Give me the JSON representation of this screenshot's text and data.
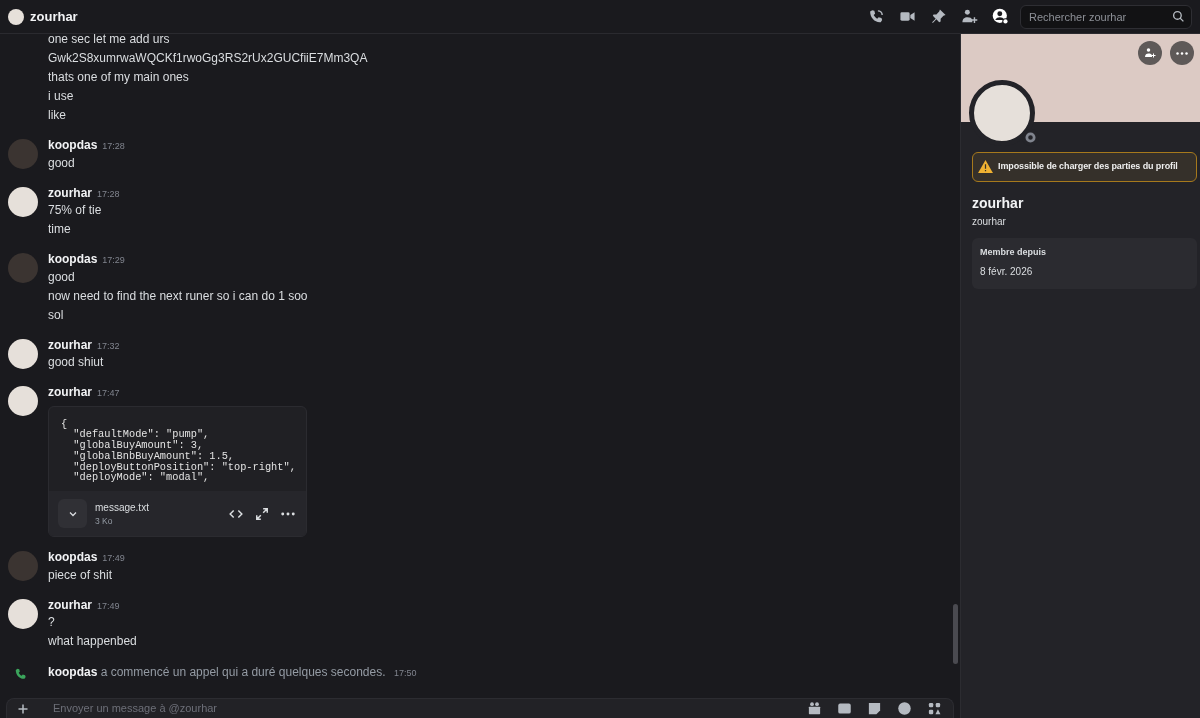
{
  "header": {
    "title": "zourhar",
    "search": {
      "placeholder": "Rechercher zourhar"
    },
    "tools": [
      {
        "kind": "call",
        "selected": false
      },
      {
        "kind": "video",
        "selected": false
      },
      {
        "kind": "pin",
        "selected": false
      },
      {
        "kind": "add-member",
        "selected": false
      },
      {
        "kind": "profile",
        "selected": true
      }
    ]
  },
  "messages": [
    {
      "kind": "continuation",
      "lines": [
        "one sec let me add urs",
        "Gwk2S8xumrwaWQCKf1rwoGg3RS2rUx2GUCfiiE7Mm3QA",
        "thats one of my main ones",
        "i use",
        "like"
      ]
    },
    {
      "kind": "message",
      "author": "koopdas",
      "color": "#3b3431",
      "time": "17:28",
      "lines": [
        "good"
      ]
    },
    {
      "kind": "message",
      "author": "zourhar",
      "color": "#e6e0da",
      "time": "17:28",
      "lines": [
        "75% of tie",
        "time"
      ]
    },
    {
      "kind": "message",
      "author": "koopdas",
      "color": "#3b3431",
      "time": "17:29",
      "lines": [
        "good",
        "now need to find the next runer so i can do 1 soo",
        "sol"
      ]
    },
    {
      "kind": "message",
      "author": "zourhar",
      "color": "#e6e0da",
      "time": "17:32",
      "lines": [
        "good shiut"
      ]
    },
    {
      "kind": "message",
      "author": "zourhar",
      "color": "#e6e0da",
      "time": "17:47",
      "attachment": {
        "code": [
          "{",
          "  \"defaultMode\": \"pump\",",
          "  \"globalBuyAmount\": 3,",
          "  \"globalBnbBuyAmount\": 1.5,",
          "  \"deployButtonPosition\": \"top-right\",",
          "  \"deployMode\": \"modal\","
        ],
        "file_name": "message.txt",
        "file_size": "3 Ko"
      }
    },
    {
      "kind": "message",
      "author": "koopdas",
      "color": "#3b3431",
      "time": "17:49",
      "lines": [
        "piece of shit"
      ]
    },
    {
      "kind": "message",
      "author": "zourhar",
      "color": "#e6e0da",
      "time": "17:49",
      "lines": [
        "?",
        "what happenbed"
      ]
    },
    {
      "kind": "call",
      "author": "koopdas",
      "text": "a commencé un appel qui a duré quelques secondes.",
      "time": "17:50"
    }
  ],
  "composer": {
    "placeholder": "Envoyer un message à @zourhar"
  },
  "profile": {
    "warning": "Impossible de charger des parties du profil",
    "display_name": "zourhar",
    "username": "zourhar",
    "member_since": {
      "label": "Membre depuis",
      "value": "8 févr. 2026"
    }
  }
}
